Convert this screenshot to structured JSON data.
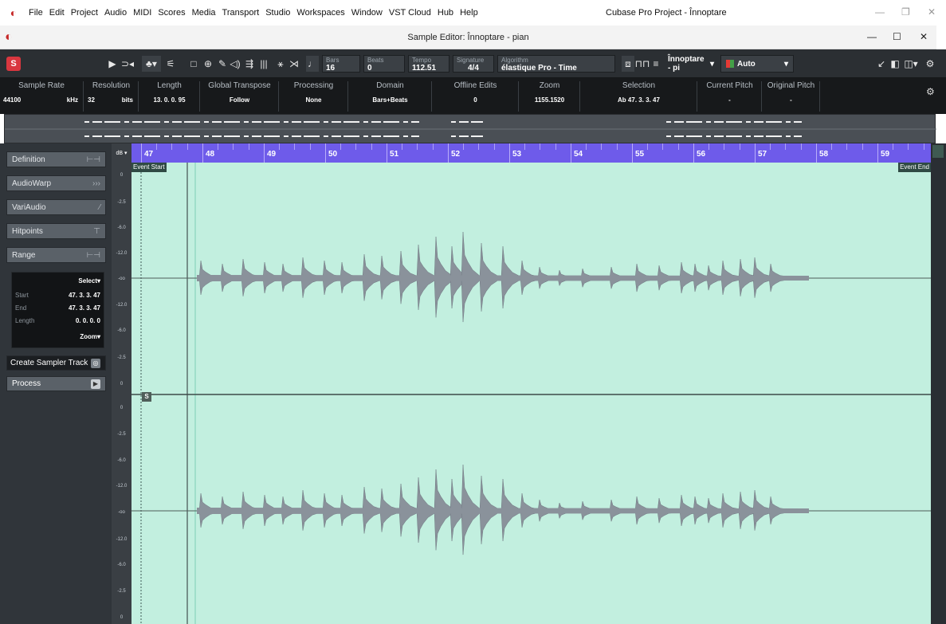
{
  "menubar": {
    "items": [
      "File",
      "Edit",
      "Project",
      "Audio",
      "MIDI",
      "Scores",
      "Media",
      "Transport",
      "Studio",
      "Workspaces",
      "Window",
      "VST Cloud",
      "Hub",
      "Help"
    ],
    "app_title": "Cubase Pro Project - Înnoptare"
  },
  "editor": {
    "title": "Sample Editor: Înnoptare - pian"
  },
  "toolbar": {
    "bars_label": "Bars",
    "bars_value": "16",
    "beats_label": "Beats",
    "beats_value": "0",
    "tempo_label": "Tempo",
    "tempo_value": "112.51",
    "signature_label": "Signature",
    "signature_value": "4/4",
    "algorithm_label": "Algorithm",
    "algorithm_value": "élastique Pro - Time",
    "track_value": "Înnoptare - pi",
    "auto_value": "Auto"
  },
  "infoline": {
    "columns": [
      {
        "header": "Sample Rate",
        "value": "44100"
      },
      {
        "header": "Resolution",
        "value": "32"
      },
      {
        "header": "Length",
        "value": "13. 0. 0. 95"
      },
      {
        "header": "Global Transpose",
        "value": "Follow"
      },
      {
        "header": "Processing",
        "value": "None"
      },
      {
        "header": "Domain",
        "value": "Bars+Beats"
      },
      {
        "header": "Offline Edits",
        "value": "0"
      },
      {
        "header": "Zoom",
        "value": "1155.1520"
      },
      {
        "header": "Selection",
        "value": "Ab 47. 3. 3. 47"
      },
      {
        "header": "Current Pitch",
        "value": "-"
      },
      {
        "header": "Original Pitch",
        "value": "-"
      }
    ],
    "khz_unit": "kHz",
    "bits_unit": "bits"
  },
  "leftpanel": {
    "tabs": [
      {
        "label": "Definition",
        "icon": "⊢⊣"
      },
      {
        "label": "AudioWarp",
        "icon": "›››"
      },
      {
        "label": "VariAudio",
        "icon": "⁄"
      },
      {
        "label": "Hitpoints",
        "icon": "⊤"
      },
      {
        "label": "Range",
        "icon": "⊢⊣"
      }
    ],
    "range": {
      "select_label": "Select",
      "start_label": "Start",
      "start_value": "47. 3. 3. 47",
      "end_label": "End",
      "end_value": "47. 3. 3. 47",
      "length_label": "Length",
      "length_value": "0. 0. 0. 0",
      "zoom_label": "Zoom"
    },
    "create_sampler_label": "Create Sampler Track",
    "process_label": "Process"
  },
  "dbscale": {
    "header": "dB",
    "labels": [
      "0",
      "-2.5",
      "-6.0",
      "-12.0",
      "-oo",
      "-12.0",
      "-6.0",
      "-2.5",
      "0",
      "0",
      "-2.5",
      "-6.0",
      "-12.0",
      "-oo",
      "-12.0",
      "-6.0",
      "-2.5",
      "0"
    ]
  },
  "ruler": {
    "bars": [
      "47",
      "48",
      "49",
      "50",
      "51",
      "52",
      "53",
      "54",
      "55",
      "56",
      "57",
      "58",
      "59"
    ]
  },
  "waveform": {
    "event_start": "Event Start",
    "event_end": "Event End",
    "s_marker": "S"
  },
  "colors": {
    "accent_purple": "#6e5bea",
    "wave_bg": "#c2efdf",
    "wave_fill": "#8a929b",
    "logo_red": "#c62828"
  }
}
